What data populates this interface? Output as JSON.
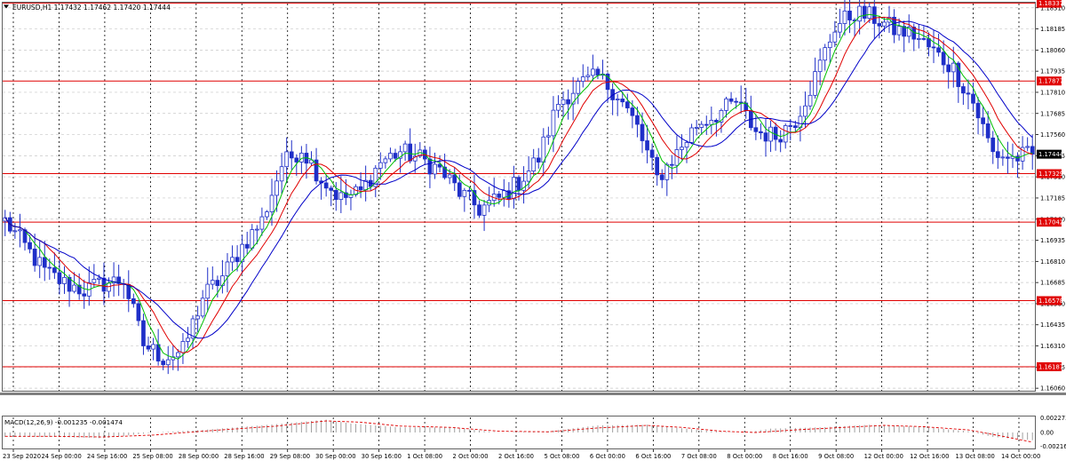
{
  "header": {
    "symbol_line": "EURUSD,H1  1.17432 1.17462 1.17420 1.17444"
  },
  "macd": {
    "label": "MACD(12,26,9) -0.001235 -0.001474",
    "ticks": [
      "0.002273",
      "0.00",
      "-0.002161"
    ],
    "ylim": [
      -0.00235,
      0.00235
    ]
  },
  "colors": {
    "candles": "#1f2fc8",
    "ma_fast": "#00c000",
    "ma_mid": "#e00000",
    "ma_slow": "#0000c8",
    "levels": "#e00000",
    "current": "#000000",
    "macd_hist": "#a0a0a0",
    "macd_signal": "#e00000"
  },
  "chart_data": [
    {
      "type": "line",
      "chart": "EURUSD H1 price",
      "ylim": [
        1.16045,
        1.18335
      ],
      "y_ticks": [
        "1.18310",
        "1.18185",
        "1.18060",
        "1.17935",
        "1.17810",
        "1.17685",
        "1.17560",
        "1.17435",
        "1.17310",
        "1.17185",
        "1.17060",
        "1.16935",
        "1.16810",
        "1.16685",
        "1.16560",
        "1.16435",
        "1.16310",
        "1.16185",
        "1.16060"
      ],
      "x_labels": [
        "23 Sep 2020",
        "24 Sep 00:00",
        "24 Sep 16:00",
        "25 Sep 08:00",
        "28 Sep 00:00",
        "28 Sep 16:00",
        "29 Sep 08:00",
        "30 Sep 00:00",
        "30 Sep 16:00",
        "1 Oct 08:00",
        "2 Oct 00:00",
        "2 Oct 16:00",
        "5 Oct 08:00",
        "6 Oct 00:00",
        "6 Oct 16:00",
        "7 Oct 08:00",
        "8 Oct 00:00",
        "8 Oct 16:00",
        "9 Oct 08:00",
        "12 Oct 00:00",
        "12 Oct 16:00",
        "13 Oct 08:00",
        "14 Oct 00:00"
      ],
      "grid": true,
      "horizontal_levels": [
        {
          "price": 1.18337,
          "label": "1.18337"
        },
        {
          "price": 1.17877,
          "label": "1.17877"
        },
        {
          "price": 1.17329,
          "label": "1.17329"
        },
        {
          "price": 1.17042,
          "label": "1.17042"
        },
        {
          "price": 1.16578,
          "label": "1.16578"
        },
        {
          "price": 1.16187,
          "label": "1.16187"
        }
      ],
      "current_price": {
        "price": 1.17444,
        "label": "1.17444"
      },
      "close_anchors": [
        [
          0,
          1.1705
        ],
        [
          4,
          1.169
        ],
        [
          8,
          1.1675
        ],
        [
          12,
          1.1668
        ],
        [
          16,
          1.1664
        ],
        [
          20,
          1.1668
        ],
        [
          24,
          1.167
        ],
        [
          28,
          1.1632
        ],
        [
          32,
          1.1624
        ],
        [
          36,
          1.1628
        ],
        [
          40,
          1.166
        ],
        [
          44,
          1.1672
        ],
        [
          48,
          1.169
        ],
        [
          52,
          1.1705
        ],
        [
          56,
          1.1738
        ],
        [
          60,
          1.1748
        ],
        [
          64,
          1.173
        ],
        [
          68,
          1.1718
        ],
        [
          72,
          1.1722
        ],
        [
          76,
          1.174
        ],
        [
          80,
          1.1746
        ],
        [
          84,
          1.1742
        ],
        [
          88,
          1.1735
        ],
        [
          92,
          1.1722
        ],
        [
          96,
          1.1712
        ],
        [
          100,
          1.1718
        ],
        [
          104,
          1.1728
        ],
        [
          108,
          1.1742
        ],
        [
          112,
          1.1775
        ],
        [
          116,
          1.1785
        ],
        [
          120,
          1.179
        ],
        [
          124,
          1.178
        ],
        [
          128,
          1.176
        ],
        [
          132,
          1.173
        ],
        [
          136,
          1.1745
        ],
        [
          140,
          1.1762
        ],
        [
          144,
          1.1768
        ],
        [
          148,
          1.1775
        ],
        [
          152,
          1.1758
        ],
        [
          156,
          1.1755
        ],
        [
          160,
          1.1765
        ],
        [
          164,
          1.179
        ],
        [
          168,
          1.182
        ],
        [
          172,
          1.1828
        ],
        [
          176,
          1.1825
        ],
        [
          180,
          1.1818
        ],
        [
          184,
          1.1815
        ],
        [
          188,
          1.1805
        ],
        [
          192,
          1.1795
        ],
        [
          196,
          1.1775
        ],
        [
          200,
          1.1745
        ],
        [
          204,
          1.1742
        ],
        [
          208,
          1.17444
        ]
      ]
    },
    {
      "type": "bar",
      "chart": "MACD(12,26,9)",
      "hist_anchors": [
        [
          0,
          -0.0007
        ],
        [
          10,
          -0.0007
        ],
        [
          20,
          -0.0009
        ],
        [
          30,
          0.0
        ],
        [
          40,
          0.0004
        ],
        [
          55,
          0.0013
        ],
        [
          65,
          0.002
        ],
        [
          70,
          0.0014
        ],
        [
          80,
          0.0008
        ],
        [
          90,
          0.0008
        ],
        [
          100,
          0.0
        ],
        [
          110,
          0.0002
        ],
        [
          120,
          0.0011
        ],
        [
          130,
          0.0012
        ],
        [
          135,
          0.0008
        ],
        [
          145,
          0.0001
        ],
        [
          150,
          0.0
        ],
        [
          155,
          0.0006
        ],
        [
          165,
          0.0008
        ],
        [
          175,
          0.0012
        ],
        [
          185,
          0.0009
        ],
        [
          195,
          0.0002
        ],
        [
          200,
          -0.0007
        ],
        [
          208,
          -0.0012
        ]
      ],
      "signal_anchors": [
        [
          0,
          -0.0006
        ],
        [
          10,
          -0.0006
        ],
        [
          20,
          -0.0007
        ],
        [
          30,
          -0.0004
        ],
        [
          40,
          0.0002
        ],
        [
          55,
          0.001
        ],
        [
          65,
          0.0018
        ],
        [
          72,
          0.0016
        ],
        [
          80,
          0.001
        ],
        [
          90,
          0.0008
        ],
        [
          100,
          0.0002
        ],
        [
          110,
          0.0001
        ],
        [
          120,
          0.0007
        ],
        [
          130,
          0.0011
        ],
        [
          137,
          0.0008
        ],
        [
          145,
          0.0002
        ],
        [
          152,
          0.0
        ],
        [
          160,
          0.0004
        ],
        [
          170,
          0.0008
        ],
        [
          178,
          0.0011
        ],
        [
          186,
          0.0009
        ],
        [
          195,
          0.0004
        ],
        [
          200,
          -0.0003
        ],
        [
          208,
          -0.0015
        ]
      ]
    }
  ]
}
